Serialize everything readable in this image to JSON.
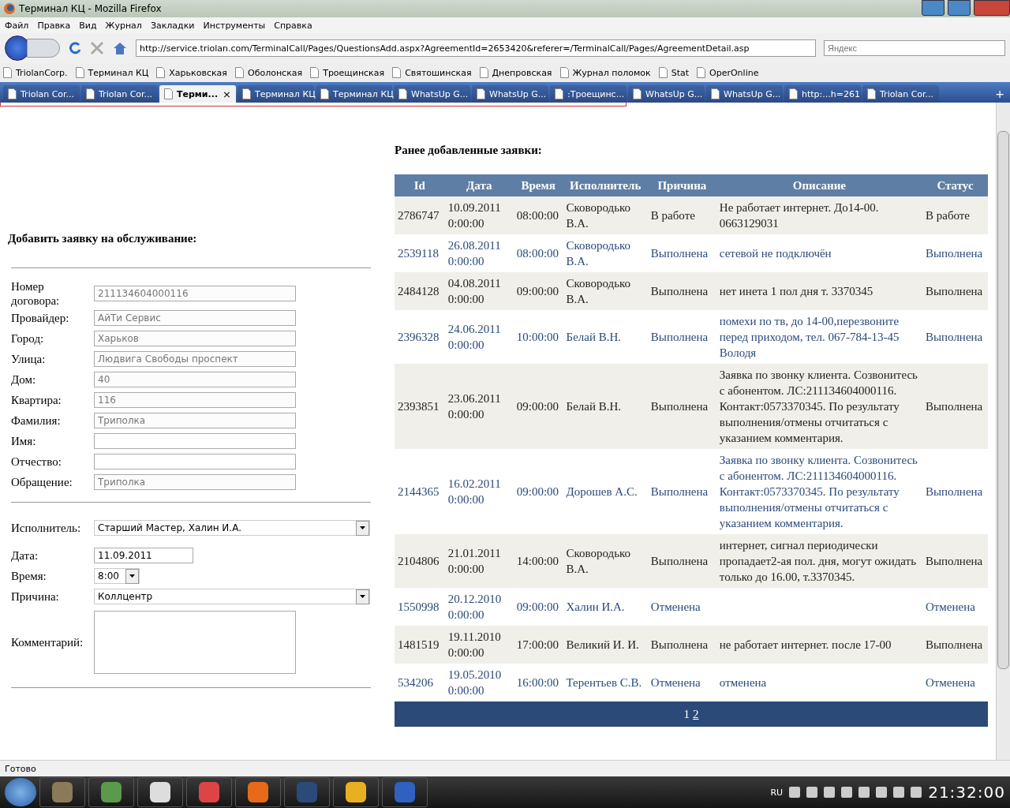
{
  "window": {
    "title": "Терминал КЦ - Mozilla Firefox"
  },
  "menu": [
    "Файл",
    "Правка",
    "Вид",
    "Журнал",
    "Закладки",
    "Инструменты",
    "Справка"
  ],
  "address": {
    "value": "http://service.triolan.com/TerminalCall/Pages/QuestionsAdd.aspx?AgreementId=2653420&referer=/TerminalCall/Pages/AgreementDetail.asp"
  },
  "search": {
    "placeholder": "Яндекс"
  },
  "bookmarks": [
    "TriolanCorp.",
    "Терминал КЦ",
    "Харьковская",
    "Оболонская",
    "Троещинская",
    "Святошинская",
    "Днепровская",
    "Журнал поломок",
    "Stat",
    "OperOnline"
  ],
  "tabs": [
    {
      "label": "Triolan Cor...",
      "selected": false
    },
    {
      "label": "Triolan Cor...",
      "selected": false
    },
    {
      "label": "Терми...",
      "selected": true
    },
    {
      "label": "Терминал КЦ",
      "selected": false
    },
    {
      "label": "Терминал КЦ",
      "selected": false
    },
    {
      "label": "WhatsUp G...",
      "selected": false
    },
    {
      "label": "WhatsUp G...",
      "selected": false
    },
    {
      "label": ":Троещинс...",
      "selected": false
    },
    {
      "label": "WhatsUp G...",
      "selected": false
    },
    {
      "label": "WhatsUp G...",
      "selected": false
    },
    {
      "label": "http:...h=261",
      "selected": false
    },
    {
      "label": "Triolan Cor...",
      "selected": false
    }
  ],
  "tab_close": "×",
  "tab_add": "+",
  "form": {
    "title": "Добавить заявку на обслуживание:",
    "groups": [
      [
        {
          "label": "Номер договора:",
          "kind": "text",
          "value": "211134604000116",
          "disabled": true
        },
        {
          "label": "Провайдер:",
          "kind": "text",
          "value": "АйТи Сервис",
          "disabled": true
        },
        {
          "label": "Город:",
          "kind": "text",
          "value": "Харьков",
          "disabled": true
        },
        {
          "label": "Улица:",
          "kind": "text",
          "value": "Людвига Свободы проспект",
          "disabled": true
        },
        {
          "label": "Дом:",
          "kind": "text",
          "value": "40",
          "disabled": true
        },
        {
          "label": "Квартира:",
          "kind": "text",
          "value": "116",
          "disabled": true
        },
        {
          "label": "Фамилия:",
          "kind": "text",
          "value": "Триполка",
          "disabled": true
        },
        {
          "label": "Имя:",
          "kind": "text"
        },
        {
          "label": "Отчество:",
          "kind": "text"
        },
        {
          "label": "Обращение:",
          "kind": "text",
          "value": "Триполка",
          "disabled": true
        }
      ],
      [
        {
          "label": "Исполнитель:",
          "kind": "select",
          "value": "Старший Мастер, Халин И.А."
        },
        {
          "label": "Дата:",
          "kind": "date",
          "value": "11.09.2011"
        },
        {
          "label": "Время:",
          "kind": "time",
          "value": "8:00"
        },
        {
          "label": "Причина:",
          "kind": "select",
          "value": "Коллцентр"
        },
        {
          "label": "Комментарий:",
          "kind": "textarea"
        }
      ]
    ]
  },
  "history": {
    "title": "Ранее добавленные заявки:",
    "columns": [
      "Id",
      "Дата",
      "Время",
      "Исполнитель",
      "Причина",
      "Описание",
      "Статус"
    ],
    "rows": [
      [
        "2786747",
        "10.09.2011 0:00:00",
        "08:00:00",
        "Сковородько В.А.",
        "В работе",
        "Не работает интернет. До14-00. 0663129031",
        "В работе"
      ],
      [
        "2539118",
        "26.08.2011 0:00:00",
        "08:00:00",
        "Сковородько В.А.",
        "Выполнена",
        "сетевой не подключён",
        "Выполнена"
      ],
      [
        "2484128",
        "04.08.2011 0:00:00",
        "09:00:00",
        "Сковородько В.А.",
        "Выполнена",
        "нет инета 1 пол дня т. 3370345",
        "Выполнена"
      ],
      [
        "2396328",
        "24.06.2011 0:00:00",
        "10:00:00",
        "Белай В.Н.",
        "Выполнена",
        "помехи по тв, до 14-00,перезвоните перед приходом, тел. 067-784-13-45 Володя",
        "Выполнена"
      ],
      [
        "2393851",
        "23.06.2011 0:00:00",
        "09:00:00",
        "Белай В.Н.",
        "Выполнена",
        "Заявка по звонку клиента. Созвонитесь с абонентом. ЛС:211134604000116. Контакт:0573370345. По результату выполнения/отмены отчитаться с указанием комментария.",
        "Выполнена"
      ],
      [
        "2144365",
        "16.02.2011 0:00:00",
        "09:00:00",
        "Дорошев А.С.",
        "Выполнена",
        "Заявка по звонку клиента. Созвонитесь с абонентом. ЛС:211134604000116. Контакт:0573370345. По результату выполнения/отмены отчитаться с указанием комментария.",
        "Выполнена"
      ],
      [
        "2104806",
        "21.01.2011 0:00:00",
        "14:00:00",
        "Сковородько В.А.",
        "Выполнена",
        "интернет, сигнал периодически пропадает2-ая пол. дня, могут ожидать только до 16.00, т.3370345.",
        "Выполнена"
      ],
      [
        "1550998",
        "20.12.2010 0:00:00",
        "09:00:00",
        "Халин И.А.",
        "Отменена",
        "",
        "Отменена"
      ],
      [
        "1481519",
        "19.11.2010 0:00:00",
        "17:00:00",
        "Великий И. И.",
        "Выполнена",
        "не работает интернет. после 17-00",
        "Выполнена"
      ],
      [
        "534206",
        "19.05.2010 0:00:00",
        "16:00:00",
        "Терентьев С.В.",
        "Отменена",
        "отменена",
        "Отменена"
      ]
    ],
    "pages": [
      {
        "label": "1",
        "selected": true
      },
      {
        "label": "2",
        "selected": false
      }
    ]
  },
  "status_bar": "Готово",
  "tray": {
    "language": "RU",
    "clock": "21:32:00"
  }
}
